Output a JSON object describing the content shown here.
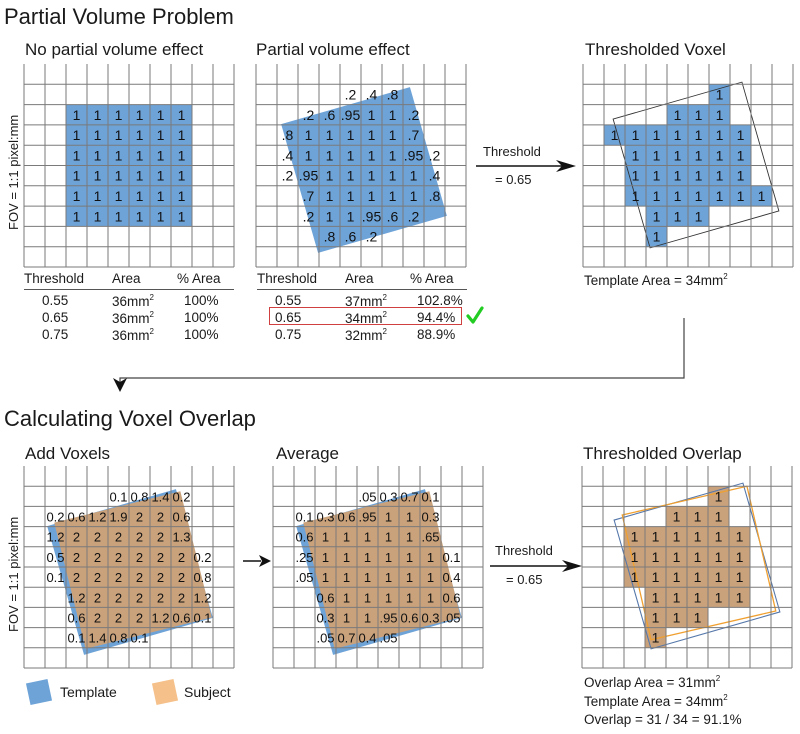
{
  "section1": {
    "title": "Partial Volume Problem",
    "fov_label": "FOV = 1:1 pixel:mm",
    "panel_no_pv": {
      "title": "No partial volume effect",
      "fill_color": "#6ea3d8",
      "cells": [
        [
          null,
          null,
          null,
          null,
          null,
          null,
          null,
          null,
          null,
          null
        ],
        [
          null,
          null,
          null,
          null,
          null,
          null,
          null,
          null,
          null,
          null
        ],
        [
          null,
          null,
          "1",
          "1",
          "1",
          "1",
          "1",
          "1",
          null,
          null
        ],
        [
          null,
          null,
          "1",
          "1",
          "1",
          "1",
          "1",
          "1",
          null,
          null
        ],
        [
          null,
          null,
          "1",
          "1",
          "1",
          "1",
          "1",
          "1",
          null,
          null
        ],
        [
          null,
          null,
          "1",
          "1",
          "1",
          "1",
          "1",
          "1",
          null,
          null
        ],
        [
          null,
          null,
          "1",
          "1",
          "1",
          "1",
          "1",
          "1",
          null,
          null
        ],
        [
          null,
          null,
          "1",
          "1",
          "1",
          "1",
          "1",
          "1",
          null,
          null
        ],
        [
          null,
          null,
          null,
          null,
          null,
          null,
          null,
          null,
          null,
          null
        ],
        [
          null,
          null,
          null,
          null,
          null,
          null,
          null,
          null,
          null,
          null
        ]
      ],
      "table": {
        "headers": [
          "Threshold",
          "Area",
          "% Area"
        ],
        "rows": [
          [
            "0.55",
            "36mm",
            "100%"
          ],
          [
            "0.65",
            "36mm",
            "100%"
          ],
          [
            "0.75",
            "36mm",
            "100%"
          ]
        ],
        "unit_superscript": "2"
      }
    },
    "panel_pv": {
      "title": "Partial volume effect",
      "fill_color": "#6ea3d8",
      "cells": [
        [
          null,
          null,
          null,
          null,
          null,
          null,
          null,
          null,
          null,
          null
        ],
        [
          null,
          null,
          null,
          null,
          ".2",
          ".4",
          ".8",
          null,
          null,
          null
        ],
        [
          null,
          null,
          ".2",
          ".6",
          ".95",
          "1",
          "1",
          ".2",
          null,
          null
        ],
        [
          null,
          ".8",
          "1",
          "1",
          "1",
          "1",
          "1",
          ".7",
          null,
          null
        ],
        [
          null,
          ".4",
          "1",
          "1",
          "1",
          "1",
          "1",
          ".95",
          ".2",
          null
        ],
        [
          null,
          ".2",
          ".95",
          "1",
          "1",
          "1",
          "1",
          "1",
          ".4",
          null
        ],
        [
          null,
          null,
          ".7",
          "1",
          "1",
          "1",
          "1",
          "1",
          ".8",
          null
        ],
        [
          null,
          null,
          ".2",
          "1",
          "1",
          ".95",
          ".6",
          ".2",
          null,
          null
        ],
        [
          null,
          null,
          null,
          ".8",
          ".6",
          ".2",
          null,
          null,
          null,
          null
        ],
        [
          null,
          null,
          null,
          null,
          null,
          null,
          null,
          null,
          null,
          null
        ]
      ],
      "table": {
        "headers": [
          "Threshold",
          "Area",
          "% Area"
        ],
        "rows": [
          [
            "0.55",
            "37mm",
            "102.8%"
          ],
          [
            "0.65",
            "34mm",
            "94.4%"
          ],
          [
            "0.75",
            "32mm",
            "88.9%"
          ]
        ],
        "unit_superscript": "2",
        "highlighted_row": 1,
        "highlight_color": "#d04040",
        "check_color": "#22cc22",
        "check_icon": "checkmark"
      }
    },
    "arrow": {
      "label": "Threshold",
      "value": "= 0.65"
    },
    "panel_thresholded": {
      "title": "Thresholded Voxel",
      "fill_color": "#6ea3d8",
      "cells": [
        [
          null,
          null,
          null,
          null,
          null,
          null,
          null,
          null,
          null,
          null
        ],
        [
          null,
          null,
          null,
          null,
          null,
          null,
          "1",
          null,
          null,
          null
        ],
        [
          null,
          null,
          null,
          null,
          "1",
          "1",
          "1",
          null,
          null,
          null
        ],
        [
          null,
          "1",
          "1",
          "1",
          "1",
          "1",
          "1",
          "1",
          null,
          null
        ],
        [
          null,
          null,
          "1",
          "1",
          "1",
          "1",
          "1",
          "1",
          null,
          null
        ],
        [
          null,
          null,
          "1",
          "1",
          "1",
          "1",
          "1",
          "1",
          null,
          null
        ],
        [
          null,
          null,
          "1",
          "1",
          "1",
          "1",
          "1",
          "1",
          "1",
          null
        ],
        [
          null,
          null,
          null,
          "1",
          "1",
          "1",
          null,
          null,
          null,
          null
        ],
        [
          null,
          null,
          null,
          "1",
          null,
          null,
          null,
          null,
          null,
          null
        ],
        [
          null,
          null,
          null,
          null,
          null,
          null,
          null,
          null,
          null,
          null
        ]
      ],
      "caption": "Template Area = 34mm",
      "caption_superscript": "2"
    }
  },
  "section2": {
    "title": "Calculating Voxel Overlap",
    "fov_label": "FOV = 1:1 pixel:mm",
    "template_color": "#6ea3d8",
    "subject_color": "#f5c08a",
    "overlap_color": "#c9a27c",
    "panel_add": {
      "title": "Add Voxels",
      "cells": [
        [
          null,
          null,
          null,
          null,
          null,
          null,
          null,
          null,
          null,
          null
        ],
        [
          null,
          null,
          null,
          null,
          "0.1",
          "0.8",
          "1.4",
          "0.2",
          null,
          null
        ],
        [
          null,
          "0.2",
          "0.6",
          "1.2",
          "1.9",
          "2",
          "2",
          "0.6",
          null,
          null
        ],
        [
          null,
          "1.2",
          "2",
          "2",
          "2",
          "2",
          "2",
          "1.3",
          null,
          null
        ],
        [
          null,
          "0.5",
          "2",
          "2",
          "2",
          "2",
          "2",
          "2",
          "0.2",
          null
        ],
        [
          null,
          "0.1",
          "2",
          "2",
          "2",
          "2",
          "2",
          "2",
          "0.8",
          null
        ],
        [
          null,
          null,
          "1.2",
          "2",
          "2",
          "2",
          "2",
          "2",
          "1.2",
          null
        ],
        [
          null,
          null,
          "0.6",
          "2",
          "2",
          "2",
          "1.2",
          "0.6",
          "0.1",
          null
        ],
        [
          null,
          null,
          "0.1",
          "1.4",
          "0.8",
          "0.1",
          null,
          null,
          null,
          null
        ],
        [
          null,
          null,
          null,
          null,
          null,
          null,
          null,
          null,
          null,
          null
        ]
      ]
    },
    "panel_avg": {
      "title": "Average",
      "cells": [
        [
          null,
          null,
          null,
          null,
          null,
          null,
          null,
          null,
          null,
          null
        ],
        [
          null,
          null,
          null,
          null,
          ".05",
          "0.3",
          "0.7",
          "0.1",
          null,
          null
        ],
        [
          null,
          "0.1",
          "0.3",
          "0.6",
          ".95",
          "1",
          "1",
          "0.3",
          null,
          null
        ],
        [
          null,
          "0.6",
          "1",
          "1",
          "1",
          "1",
          "1",
          ".65",
          null,
          null
        ],
        [
          null,
          ".25",
          "1",
          "1",
          "1",
          "1",
          "1",
          "1",
          "0.1",
          null
        ],
        [
          null,
          ".05",
          "1",
          "1",
          "1",
          "1",
          "1",
          "1",
          "0.4",
          null
        ],
        [
          null,
          null,
          "0.6",
          "1",
          "1",
          "1",
          "1",
          "1",
          "0.6",
          null
        ],
        [
          null,
          null,
          "0.3",
          "1",
          "1",
          ".95",
          "0.6",
          "0.3",
          ".05",
          null
        ],
        [
          null,
          null,
          ".05",
          "0.7",
          "0.4",
          ".05",
          null,
          null,
          null,
          null
        ],
        [
          null,
          null,
          null,
          null,
          null,
          null,
          null,
          null,
          null,
          null
        ]
      ]
    },
    "arrow": {
      "label": "Threshold",
      "value": "= 0.65"
    },
    "panel_overlap": {
      "title": "Thresholded Overlap",
      "cells": [
        [
          null,
          null,
          null,
          null,
          null,
          null,
          null,
          null,
          null,
          null
        ],
        [
          null,
          null,
          null,
          null,
          null,
          null,
          "1",
          null,
          null,
          null
        ],
        [
          null,
          null,
          null,
          null,
          "1",
          "1",
          "1",
          null,
          null,
          null
        ],
        [
          null,
          null,
          "1",
          "1",
          "1",
          "1",
          "1",
          "1",
          null,
          null
        ],
        [
          null,
          null,
          "1",
          "1",
          "1",
          "1",
          "1",
          "1",
          null,
          null
        ],
        [
          null,
          null,
          "1",
          "1",
          "1",
          "1",
          "1",
          "1",
          null,
          null
        ],
        [
          null,
          null,
          null,
          "1",
          "1",
          "1",
          "1",
          "1",
          null,
          null
        ],
        [
          null,
          null,
          null,
          "1",
          "1",
          "1",
          null,
          null,
          null,
          null
        ],
        [
          null,
          null,
          null,
          "1",
          null,
          null,
          null,
          null,
          null,
          null
        ],
        [
          null,
          null,
          null,
          null,
          null,
          null,
          null,
          null,
          null,
          null
        ]
      ],
      "captions": [
        {
          "text": "Overlap Area = 31mm",
          "sup": "2"
        },
        {
          "text": "Template Area = 34mm",
          "sup": "2"
        },
        {
          "text": "Overlap = 31 / 34 = 91.1%",
          "sup": ""
        }
      ]
    },
    "legend": [
      {
        "label": "Template",
        "color": "#6ea3d8"
      },
      {
        "label": "Subject",
        "color": "#f5c08a"
      }
    ]
  }
}
